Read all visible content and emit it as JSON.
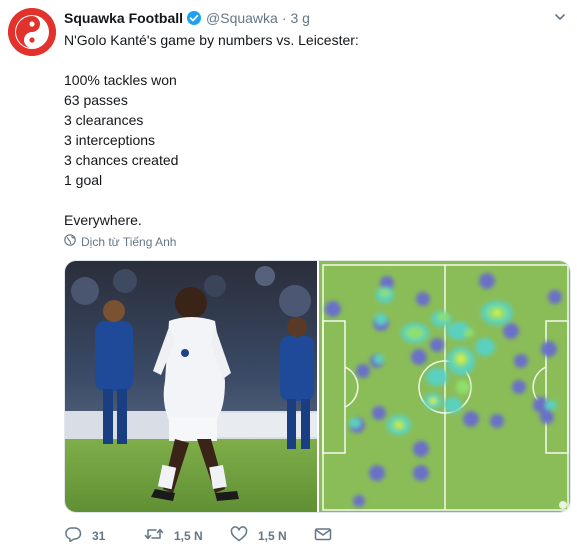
{
  "author": {
    "display_name": "Squawka Football",
    "handle": "@Squawka",
    "separator": "·",
    "time": "3 g",
    "verified_color": "#1da1f2",
    "avatar_color": "#e2322c"
  },
  "tweet": {
    "text": "N'Golo Kanté's game by numbers vs. Leicester:\n\n100% tackles won\n63 passes\n3 clearances\n3 interceptions\n3 chances created\n1 goal\n\nEverywhere."
  },
  "translate": {
    "label": "Dịch từ Tiếng Anh"
  },
  "media": {
    "pitch_color": "#8abd58",
    "heat_colors": [
      "#6a70c8",
      "#5ad0c0",
      "#8ee06a",
      "#d8ec50"
    ]
  },
  "actions": {
    "replies": "31",
    "retweets": "1,5 N",
    "likes": "1,5 N"
  },
  "icons": [
    "verified-badge-icon",
    "chevron-down-icon",
    "globe-icon",
    "reply-icon",
    "retweet-icon",
    "heart-icon",
    "envelope-icon"
  ]
}
